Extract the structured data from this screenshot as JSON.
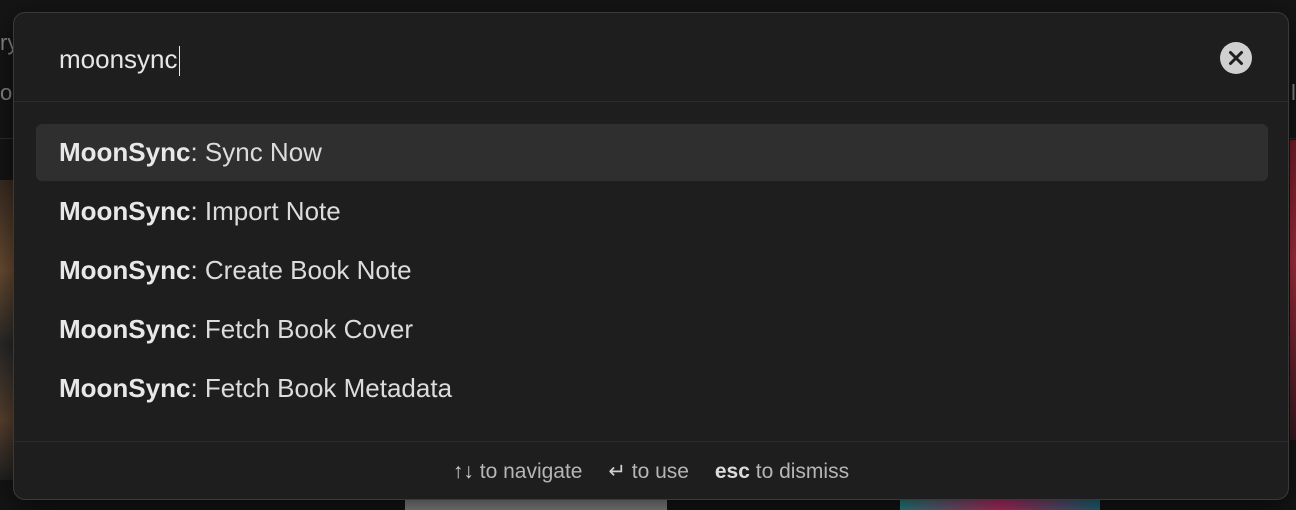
{
  "background": {
    "text_a": "ry",
    "text_b": "o",
    "text_c": "l"
  },
  "palette": {
    "search": {
      "value": "moonsync",
      "clear_icon": "close-circle-icon"
    },
    "results": [
      {
        "prefix": "MoonSync",
        "label": ": Sync Now",
        "selected": true
      },
      {
        "prefix": "MoonSync",
        "label": ": Import Note",
        "selected": false
      },
      {
        "prefix": "MoonSync",
        "label": ": Create Book Note",
        "selected": false
      },
      {
        "prefix": "MoonSync",
        "label": ": Fetch Book Cover",
        "selected": false
      },
      {
        "prefix": "MoonSync",
        "label": ": Fetch Book Metadata",
        "selected": false
      }
    ],
    "footer": {
      "navigate_key": "↑↓",
      "navigate_label": "to navigate",
      "use_key": "↵",
      "use_label": "to use",
      "dismiss_key": "esc",
      "dismiss_label": "to dismiss"
    }
  }
}
